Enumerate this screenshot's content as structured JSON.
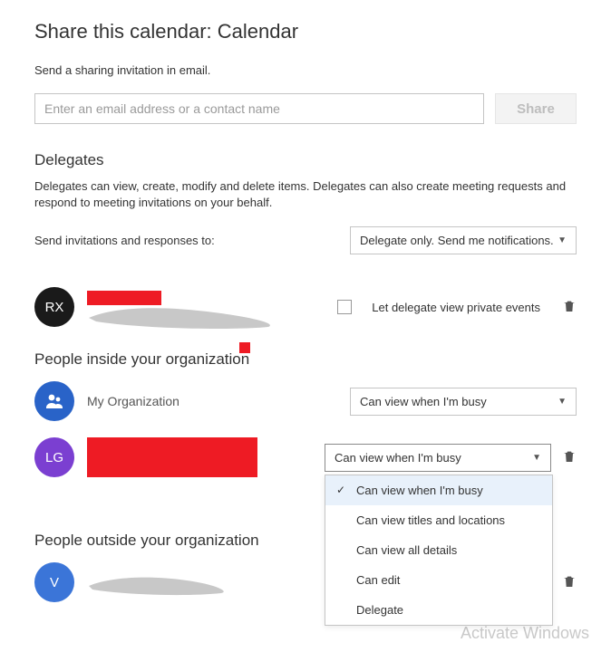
{
  "header": {
    "title": "Share this calendar: Calendar"
  },
  "invite": {
    "intro": "Send a sharing invitation in email.",
    "placeholder": "Enter an email address or a contact name",
    "share_btn": "Share"
  },
  "delegates": {
    "heading": "Delegates",
    "desc": "Delegates can view, create, modify and delete items. Delegates can also create meeting requests and respond to meeting invitations on your behalf.",
    "send_label": "Send invitations and responses to:",
    "send_value": "Delegate only. Send me notifications.",
    "entries": [
      {
        "initials": "RX",
        "private_label": "Let delegate view private events"
      }
    ]
  },
  "inside": {
    "heading": "People inside your organization",
    "org_label": "My Organization",
    "org_permission": "Can view when I'm busy",
    "entries": [
      {
        "initials": "LG",
        "permission": "Can view when I'm busy"
      }
    ]
  },
  "outside": {
    "heading": "People outside your organization",
    "entries": [
      {
        "initials": "V"
      }
    ]
  },
  "permission_options": [
    "Can view when I'm busy",
    "Can view titles and locations",
    "Can view all details",
    "Can edit",
    "Delegate"
  ],
  "watermark": "Activate Windows"
}
